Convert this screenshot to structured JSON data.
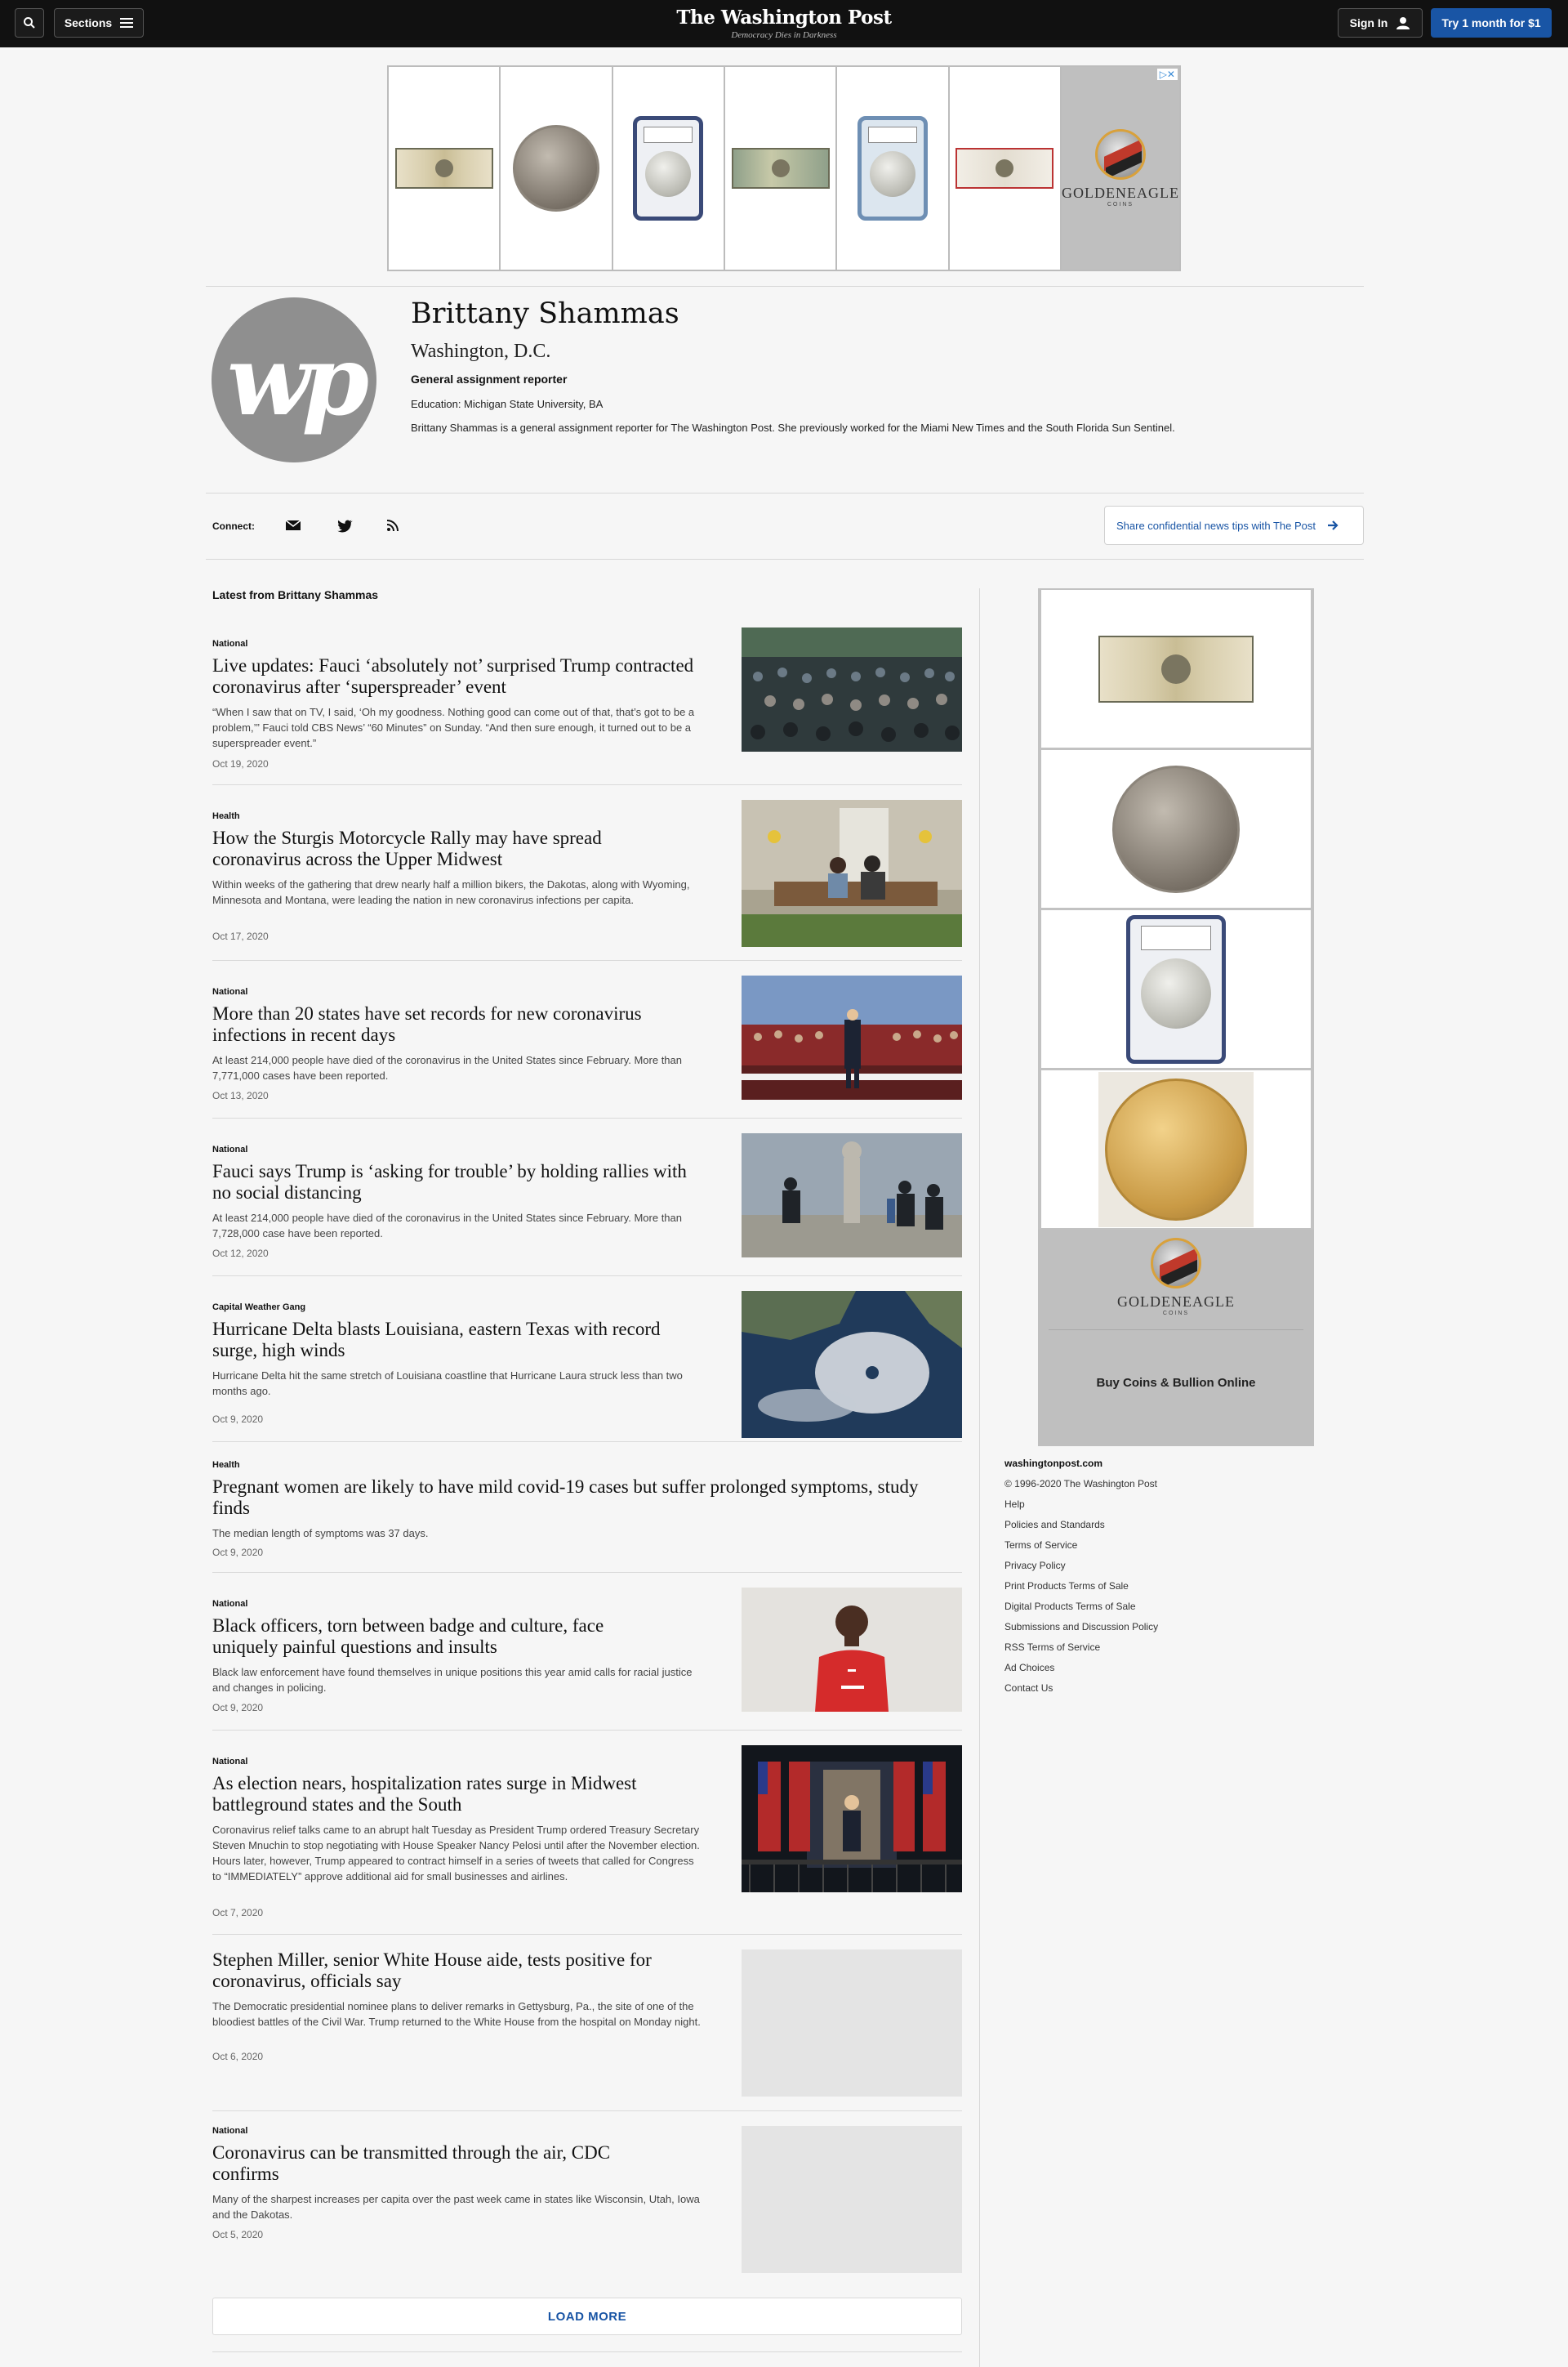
{
  "header": {
    "sections_label": "Sections",
    "logo": "The Washington Post",
    "tagline": "Democracy Dies in Darkness",
    "signin_label": "Sign In",
    "cta_label": "Try 1 month for $1"
  },
  "top_ad": {
    "brand_name": "GOLDENEAGLE",
    "brand_sub": "COINS"
  },
  "author": {
    "name": "Brittany Shammas",
    "location": "Washington, D.C.",
    "title": "General assignment reporter",
    "education": "Education: Michigan State University, BA",
    "bio": "Brittany Shammas is a general assignment reporter for The Washington Post. She previously worked for the Miami New Times and the South Florida Sun Sentinel."
  },
  "connect": {
    "label": "Connect:",
    "icons": [
      "email-icon",
      "twitter-icon",
      "rss-icon"
    ],
    "tips_label": "Share confidential news tips with The Post"
  },
  "latest_label": "Latest from Brittany Shammas",
  "articles": [
    {
      "kicker": "National",
      "headline": "Live updates: Fauci ‘absolutely not’ surprised Trump contracted coronavirus after ‘superspreader’ event",
      "blurb": "“When I saw that on TV, I said, ‘Oh my goodness. Nothing good can come out of that, that’s got to be a problem,’” Fauci told CBS News’ “60 Minutes” on Sunday. “And then sure enough, it turned out to be a superspreader event.”",
      "date": "Oct 19, 2020"
    },
    {
      "kicker": "Health",
      "headline": "How the Sturgis Motorcycle Rally may have spread coronavirus across the Upper Midwest",
      "blurb": "Within weeks of the gathering that drew nearly half a million bikers, the Dakotas, along with Wyoming, Minnesota and Montana, were leading the nation in new coronavirus infections per capita.",
      "date": "Oct 17, 2020"
    },
    {
      "kicker": "National",
      "headline": "More than 20 states have set records for new coronavirus infections in recent days",
      "blurb": "At least 214,000 people have died of the coronavirus in the United States since February. More than 7,771,000 cases have been reported.",
      "date": "Oct 13, 2020"
    },
    {
      "kicker": "National",
      "headline": "Fauci says Trump is ‘asking for trouble’ by holding rallies with no social distancing",
      "blurb": "At least 214,000 people have died of the coronavirus in the United States since February. More than 7,728,000 case have been reported.",
      "date": "Oct 12, 2020"
    },
    {
      "kicker": "Capital Weather Gang",
      "headline": "Hurricane Delta blasts Louisiana, eastern Texas with record surge, high winds",
      "blurb": "Hurricane Delta hit the same stretch of Louisiana coastline that Hurricane Laura struck less than two months ago.",
      "date": "Oct 9, 2020"
    },
    {
      "kicker": "Health",
      "headline": "Pregnant women are likely to have mild covid-19 cases but suffer prolonged symptoms, study finds",
      "blurb": "The median length of symptoms was 37 days.",
      "date": "Oct 9, 2020"
    },
    {
      "kicker": "National",
      "headline": "Black officers, torn between badge and culture, face uniquely painful questions and insults",
      "blurb": "Black law enforcement have found themselves in unique positions this year amid calls for racial justice and changes in policing.",
      "date": "Oct 9, 2020"
    },
    {
      "kicker": "National",
      "headline": "As election nears, hospitalization rates surge in Midwest battleground states and the South",
      "blurb": "Coronavirus relief talks came to an abrupt halt Tuesday as President Trump ordered Treasury Secretary Steven Mnuchin to stop negotiating with House Speaker Nancy Pelosi until after the November election. Hours later, however, Trump appeared to contract himself in a series of tweets that called for Congress to “IMMEDIATELY” approve additional aid for small businesses and airlines.",
      "date": "Oct 7, 2020"
    },
    {
      "kicker": "",
      "headline": "Stephen Miller, senior White House aide, tests positive for coronavirus, officials say",
      "blurb": "The Democratic presidential nominee plans to deliver remarks in Gettysburg, Pa., the site of one of the bloodiest battles of the Civil War. Trump returned to the White House from the hospital on Monday night.",
      "date": "Oct 6, 2020"
    },
    {
      "kicker": "National",
      "headline": "Coronavirus can be transmitted through the air, CDC confirms",
      "blurb": "Many of the sharpest increases per capita over the past week came in states like Wisconsin, Utah, Iowa and the Dakotas.",
      "date": "Oct 5, 2020"
    }
  ],
  "load_more": "LOAD MORE",
  "side_ad": {
    "brand_name": "GOLDENEAGLE",
    "brand_sub": "COINS",
    "cta": "Buy Coins & Bullion Online"
  },
  "footer": {
    "site": "washingtonpost.com",
    "copyright": "© 1996-2020 The Washington Post",
    "links": [
      "Help",
      "Policies and Standards",
      "Terms of Service",
      "Privacy Policy",
      "Print Products Terms of Sale",
      "Digital Products Terms of Sale",
      "Submissions and Discussion Policy",
      "RSS Terms of Service",
      "Ad Choices",
      "Contact Us"
    ]
  },
  "colors": {
    "brand_blue": "#1955a5",
    "topbar": "#111111",
    "page_bg": "#f6f6f6"
  }
}
